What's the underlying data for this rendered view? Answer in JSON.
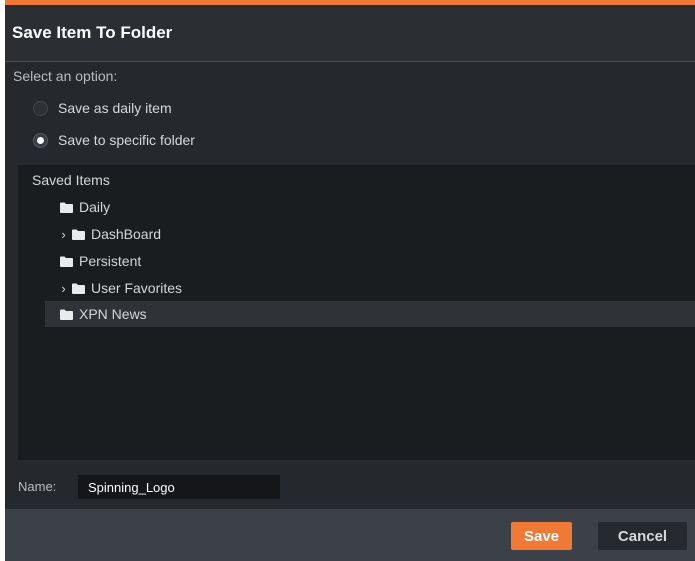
{
  "dialog": {
    "title": "Save Item To Folder",
    "accent_color": "#f07a35"
  },
  "options": {
    "prompt": "Select an option:",
    "daily": {
      "label": "Save as daily item",
      "checked": false
    },
    "specific": {
      "label": "Save to specific folder",
      "checked": true
    }
  },
  "tree": {
    "root": "Saved Items",
    "items": [
      {
        "label": "Daily",
        "icon": "folder-icon",
        "expandable": false,
        "selected": false
      },
      {
        "label": "DashBoard",
        "icon": "folder-icon",
        "expandable": true,
        "selected": false
      },
      {
        "label": "Persistent",
        "icon": "folder-icon",
        "expandable": false,
        "selected": false
      },
      {
        "label": "User Favorites",
        "icon": "folder-icon",
        "expandable": true,
        "selected": false
      },
      {
        "label": "XPN News",
        "icon": "folder-icon",
        "expandable": false,
        "selected": true
      }
    ],
    "chevron_icon": "chevron-right-icon"
  },
  "name_field": {
    "label": "Name:",
    "value": "Spinning_Logo"
  },
  "footer": {
    "save_label": "Save",
    "cancel_label": "Cancel"
  }
}
